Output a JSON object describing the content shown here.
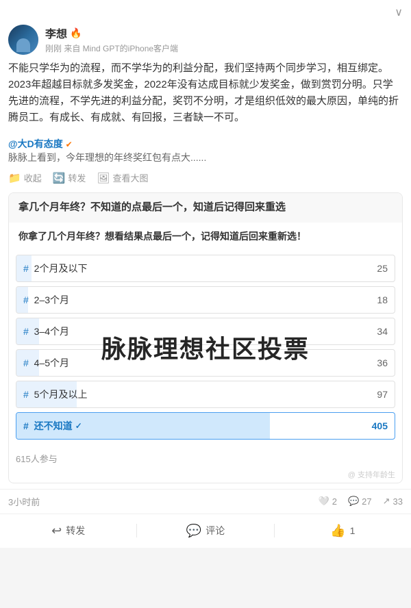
{
  "topBar": {
    "chevron": "∨"
  },
  "author": {
    "name": "李想",
    "verified": true,
    "verifiedIcon": "🔥",
    "meta": "刚刚  来自 Mind GPT的iPhone客户端"
  },
  "postContent": "不能只学华为的流程，而不学华为的利益分配，我们坚持两个同步学习，相互绑定。2023年超越目标就多发奖金，2022年没有达成目标就少发奖金，做到赏罚分明。只学先进的流程，不学先进的利益分配，奖罚不分明，才是组织低效的最大原因，单纯的折腾员工。有成长、有成就、有回报，三者缺一不可。",
  "quote": {
    "user": "@大D有态度",
    "verified": true,
    "verifiedIcon": "✔",
    "text": "脉脉上看到，今年理想的年终奖红包有点大......"
  },
  "actionRow": {
    "collect": "收起",
    "repost": "转发",
    "viewImage": "查看大图"
  },
  "pollCard": {
    "title": "拿几个月年终？不知道的点最后一个，知道后记得回来重选",
    "pollTitle": "你拿了几个月年终？想看结果点最后一个，记得知道后回来重新选！",
    "options": [
      {
        "id": 1,
        "label": "# 2个月及以下",
        "count": 25,
        "percent": 4,
        "selected": false
      },
      {
        "id": 2,
        "label": "# 2–3个月",
        "count": 18,
        "percent": 3,
        "selected": false
      },
      {
        "id": 3,
        "label": "# 3–4个月",
        "count": 34,
        "percent": 6,
        "selected": false
      },
      {
        "id": 4,
        "label": "# 4–5个月",
        "count": 36,
        "percent": 6,
        "selected": false
      },
      {
        "id": 5,
        "label": "# 5个月及以上",
        "count": 97,
        "percent": 16,
        "selected": false
      },
      {
        "id": 6,
        "label": "# 还不知道",
        "count": 405,
        "percent": 67,
        "selected": true
      }
    ],
    "participants": "615人参与",
    "watermark": "@ 支持年龄生",
    "bigWatermark": "脉脉理想社区投票"
  },
  "timestamp": {
    "time": "3小时前",
    "likes": 2,
    "comments": 27,
    "shares": 33
  },
  "bottomActions": {
    "repost": "转发",
    "comment": "评论",
    "like": "1"
  }
}
